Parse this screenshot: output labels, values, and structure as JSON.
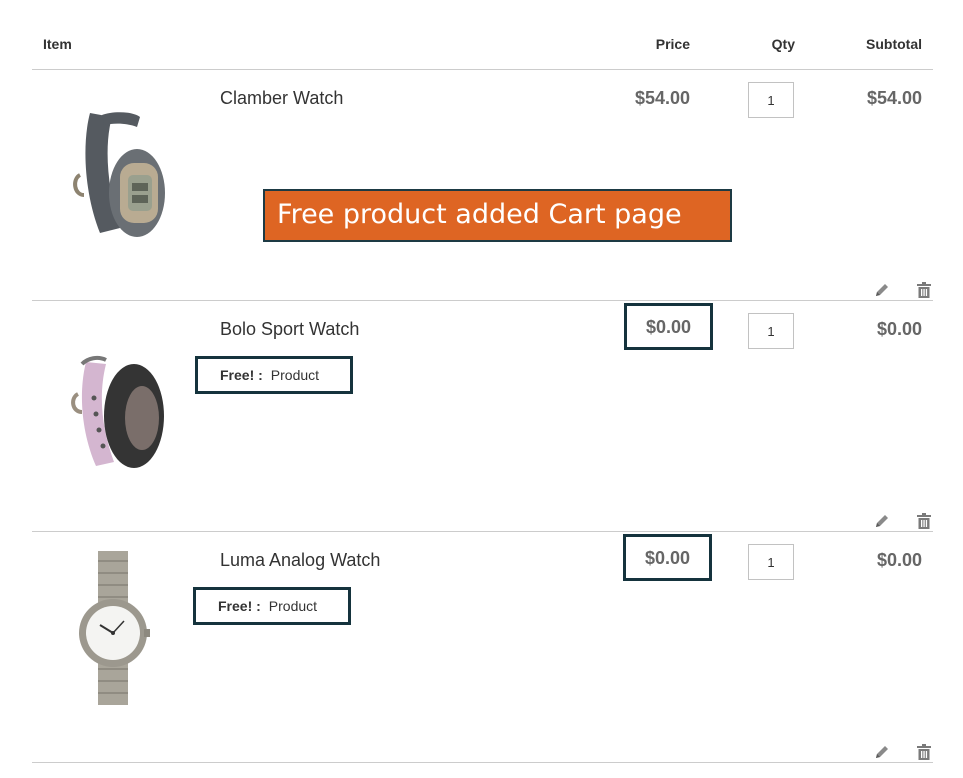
{
  "table": {
    "headers": {
      "item": "Item",
      "price": "Price",
      "qty": "Qty",
      "subtotal": "Subtotal"
    },
    "rows": [
      {
        "name": "Clamber Watch",
        "price": "$54.00",
        "qty": "1",
        "subtotal": "$54.00",
        "option_label": "",
        "option_value": ""
      },
      {
        "name": "Bolo Sport Watch",
        "price": "$0.00",
        "qty": "1",
        "subtotal": "$0.00",
        "option_label": "Free! :",
        "option_value": "Product"
      },
      {
        "name": "Luma Analog Watch",
        "price": "$0.00",
        "qty": "1",
        "subtotal": "$0.00",
        "option_label": "Free! :",
        "option_value": "Product"
      }
    ]
  },
  "banner": {
    "text": "Free product added Cart page"
  },
  "icons": {
    "edit": "pencil-icon",
    "delete": "trash-icon"
  },
  "colors": {
    "banner_bg": "#de6523",
    "highlight_border": "#15333d"
  }
}
